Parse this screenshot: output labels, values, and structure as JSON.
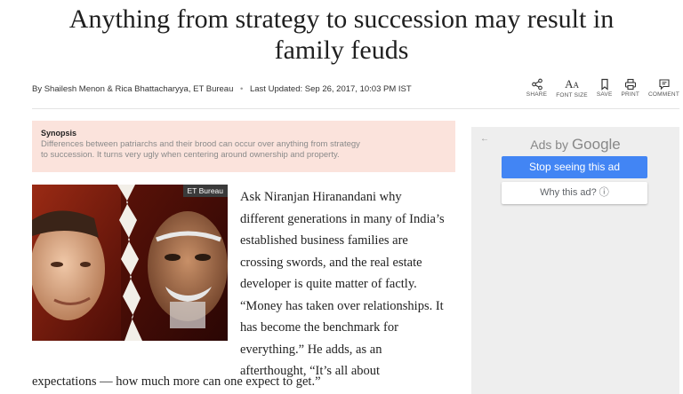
{
  "article": {
    "headline_line1": "Anything from strategy to succession may result in",
    "headline_line2": "family feuds",
    "byline": "By Shailesh Menon & Rica Bhattacharyya, ET Bureau",
    "separator": "•",
    "last_updated": "Last Updated: Sep 26, 2017, 10:03 PM IST",
    "synopsis_title": "Synopsis",
    "synopsis_text_line1": "Differences between patriarchs and their brood can occur over anything from strategy",
    "synopsis_text_line2": "to succession. It turns very ugly when centering around ownership and property.",
    "image_tag": "ET Bureau",
    "paragraph_lines": [
      "Ask Niranjan Hiranandani why",
      "different generations in many of India’s",
      "established business families are",
      "crossing swords, and the real estate",
      "developer is quite matter of factly.",
      "“Money has taken over relationships. It",
      "has become the benchmark for",
      "everything.” He adds, as an",
      "afterthought, “It’s all about"
    ],
    "paragraph_tail": "expectations — how much more can one expect to get.”"
  },
  "toolbar": {
    "share_label": "SHARE",
    "fontsize_glyph_big": "A",
    "fontsize_glyph_small": "A",
    "fontsize_label": "FONT SIZE",
    "save_label": "SAVE",
    "print_label": "PRINT",
    "comment_label": "COMMENT"
  },
  "ad": {
    "back_glyph": "←",
    "ads_by": "Ads by",
    "google": "Google",
    "stop_button": "Stop seeing this ad",
    "why_button": "Why this ad? ⓘ"
  },
  "colors": {
    "synopsis_bg": "#fbe3dc",
    "ad_button_blue": "#4285f4",
    "ad_panel_bg": "#eeeeee"
  }
}
